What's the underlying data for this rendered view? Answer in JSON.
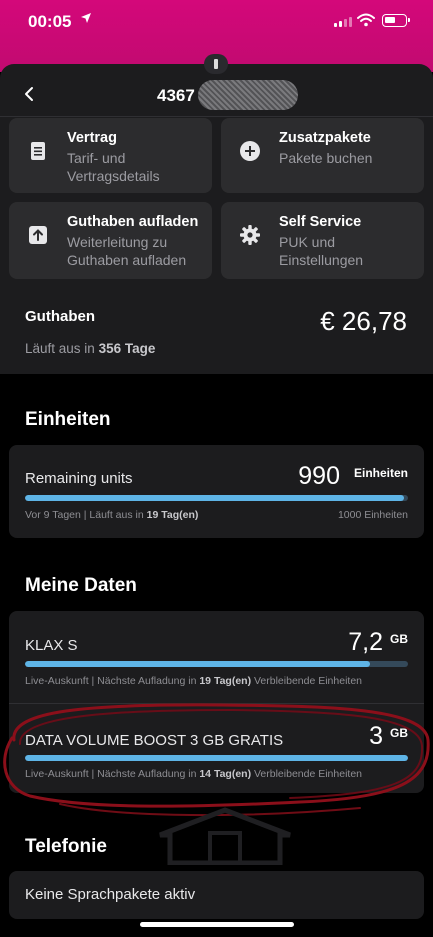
{
  "status_bar": {
    "time": "00:05",
    "location_icon": "location-arrow-icon"
  },
  "nav": {
    "back_icon": "chevron-left-icon",
    "title": "4367"
  },
  "tiles": [
    {
      "title": "Vertrag",
      "subtitle": "Tarif- und Vertragsdetails",
      "icon": "document-icon"
    },
    {
      "title": "Zusatzpakete",
      "subtitle": "Pakete buchen",
      "icon": "plus-circle-icon"
    },
    {
      "title": "Guthaben aufladen",
      "subtitle": "Weiterleitung zu Guthaben aufladen",
      "icon": "upload-icon"
    },
    {
      "title": "Self Service",
      "subtitle": "PUK und Einstellungen",
      "icon": "gear-icon"
    }
  ],
  "guthaben": {
    "label": "Guthaben",
    "amount": "€ 26,78",
    "expiry_prefix": "Läuft aus in",
    "expiry_value": "356 Tage"
  },
  "einheiten": {
    "section_title": "Einheiten",
    "label": "Remaining units",
    "value": "990",
    "unit": "Einheiten",
    "meta_prefix": "Vor 9 Tagen | Läuft aus in",
    "meta_value": "19 Tag(en)",
    "total": "1000 Einheiten",
    "fill_fraction": 0.99
  },
  "daten": {
    "section_title": "Meine Daten",
    "items": [
      {
        "label": "KLAX S",
        "value": "7,2",
        "unit": "GB",
        "meta_prefix": "Live-Auskunft | Nächste Aufladung in",
        "meta_value": "19 Tag(en)",
        "meta_suffix": "Verbleibende Einheiten",
        "fill_fraction": 0.9
      },
      {
        "label": "DATA VOLUME BOOST 3 GB GRATIS",
        "value": "3",
        "unit": "GB",
        "meta_prefix": "Live-Auskunft | Nächste Aufladung in",
        "meta_value": "14 Tag(en)",
        "meta_suffix": "Verbleibende Einheiten",
        "fill_fraction": 1.0
      }
    ]
  },
  "telefonie": {
    "section_title": "Telefonie",
    "status": "Keine Sprachpakete aktiv"
  },
  "colors": {
    "brand_magenta": "#d4087a",
    "progress_blue": "#5eb4e6",
    "annotation_red": "#8b0f1a"
  }
}
